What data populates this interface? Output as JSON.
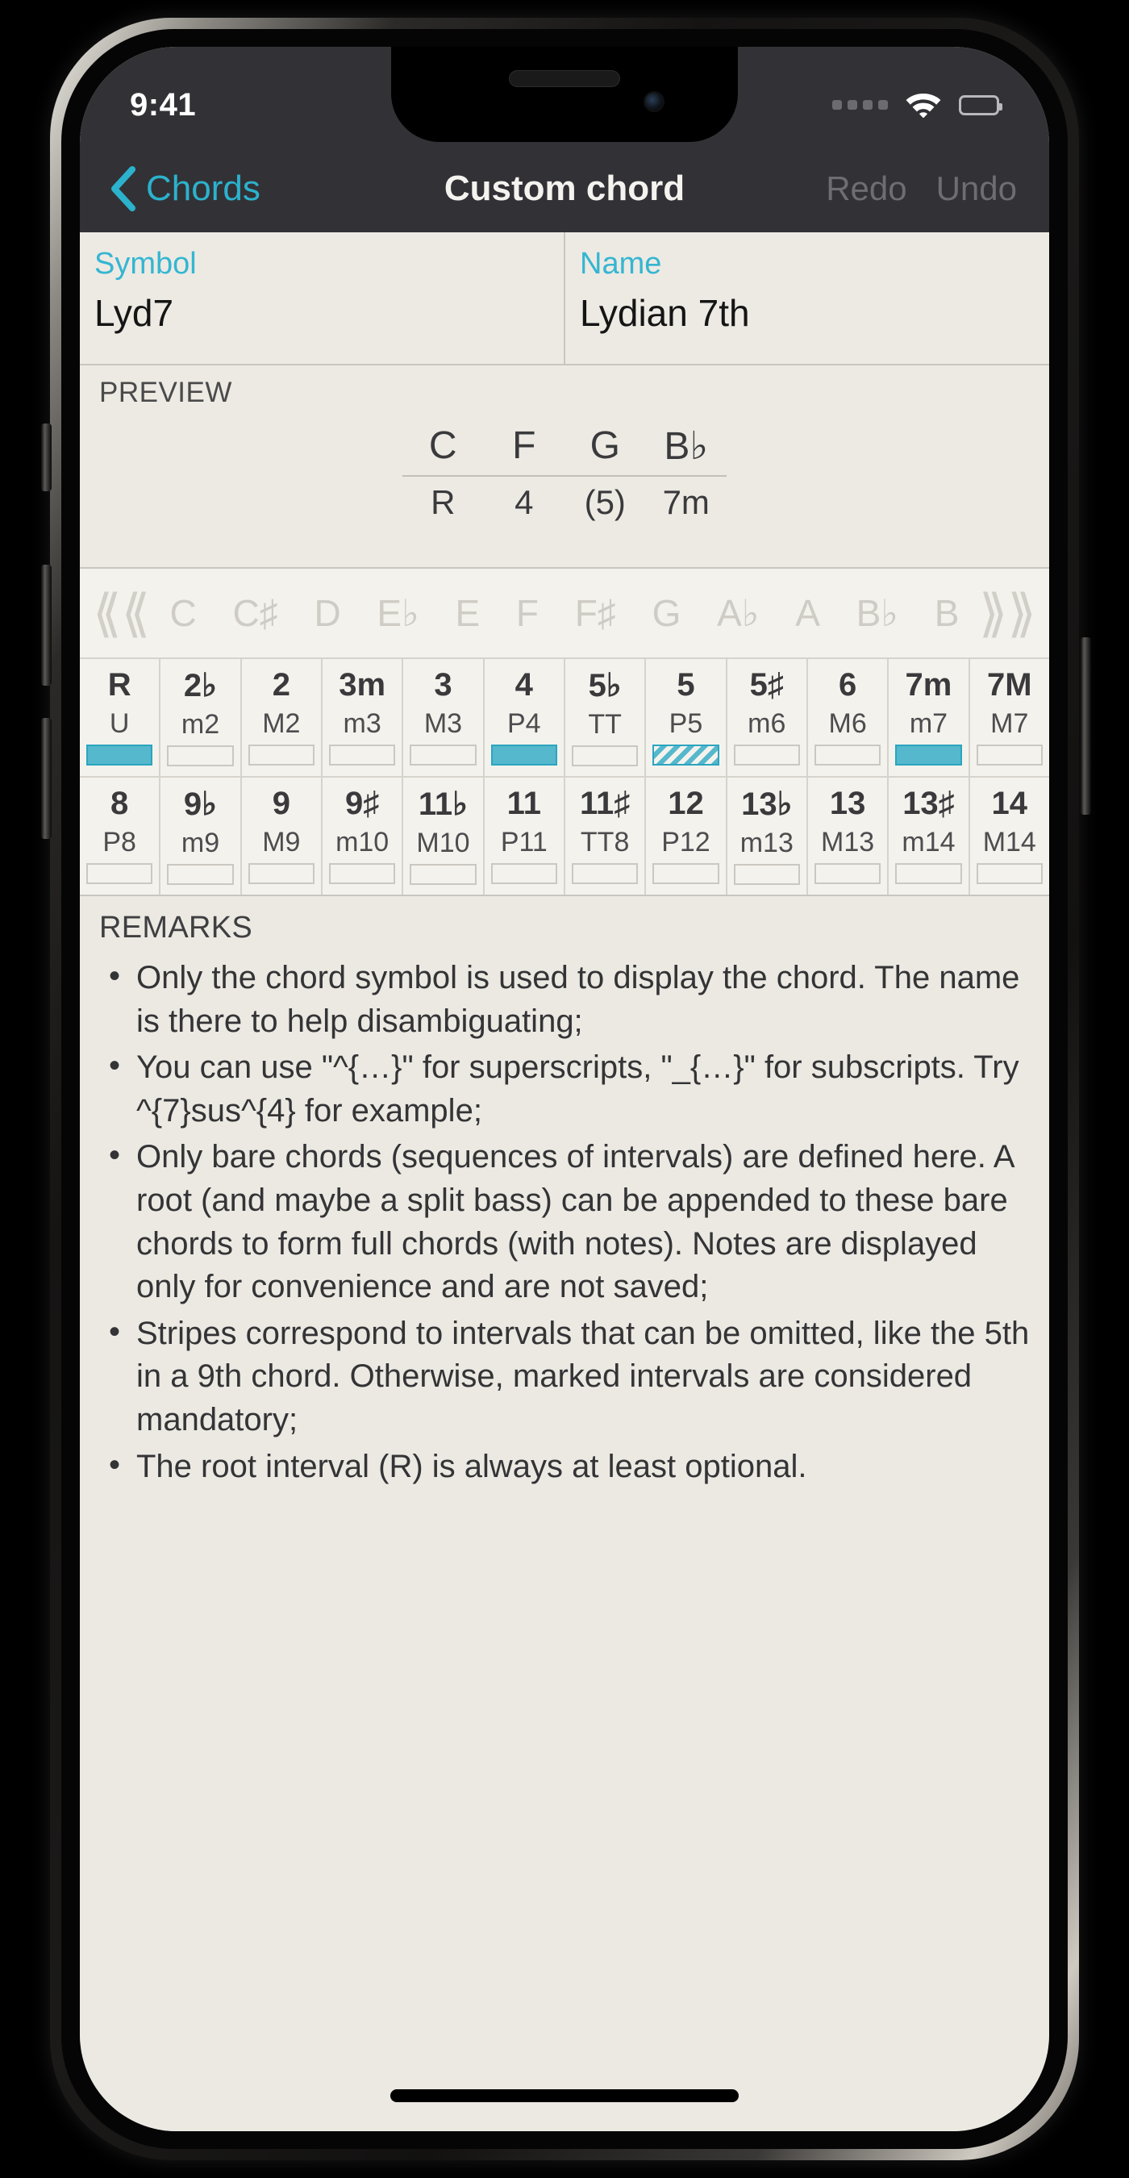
{
  "status_bar": {
    "time": "9:41",
    "cellular_icon": "cellular-dots-icon",
    "wifi_icon": "wifi-icon",
    "battery_icon": "battery-full-icon"
  },
  "nav_bar": {
    "back_icon": "chevron-left-icon",
    "back_label": "Chords",
    "title": "Custom chord",
    "redo_label": "Redo",
    "undo_label": "Undo"
  },
  "fields": {
    "symbol": {
      "label": "Symbol",
      "value": "Lyd7"
    },
    "name": {
      "label": "Name",
      "value": "Lydian 7th"
    }
  },
  "preview": {
    "label": "PREVIEW",
    "notes": [
      "C",
      "F",
      "G",
      "B♭"
    ],
    "intervals": [
      "R",
      "4",
      "(5)",
      "7m"
    ]
  },
  "note_picker": {
    "left_arrow_icon": "double-chevron-left-icon",
    "right_arrow_icon": "double-chevron-right-icon",
    "notes": [
      "C",
      "C♯",
      "D",
      "E♭",
      "E",
      "F",
      "F♯",
      "G",
      "A♭",
      "A",
      "B♭",
      "B"
    ]
  },
  "interval_grid": {
    "rows": [
      [
        {
          "main": "R",
          "sub": "U",
          "state": "on"
        },
        {
          "main": "2♭",
          "sub": "m2",
          "state": "off"
        },
        {
          "main": "2",
          "sub": "M2",
          "state": "off"
        },
        {
          "main": "3m",
          "sub": "m3",
          "state": "off"
        },
        {
          "main": "3",
          "sub": "M3",
          "state": "off"
        },
        {
          "main": "4",
          "sub": "P4",
          "state": "on"
        },
        {
          "main": "5♭",
          "sub": "TT",
          "state": "off"
        },
        {
          "main": "5",
          "sub": "P5",
          "state": "striped"
        },
        {
          "main": "5♯",
          "sub": "m6",
          "state": "off"
        },
        {
          "main": "6",
          "sub": "M6",
          "state": "off"
        },
        {
          "main": "7m",
          "sub": "m7",
          "state": "on"
        },
        {
          "main": "7M",
          "sub": "M7",
          "state": "off"
        }
      ],
      [
        {
          "main": "8",
          "sub": "P8",
          "state": "off"
        },
        {
          "main": "9♭",
          "sub": "m9",
          "state": "off"
        },
        {
          "main": "9",
          "sub": "M9",
          "state": "off"
        },
        {
          "main": "9♯",
          "sub": "m10",
          "state": "off"
        },
        {
          "main": "11♭",
          "sub": "M10",
          "state": "off"
        },
        {
          "main": "11",
          "sub": "P11",
          "state": "off"
        },
        {
          "main": "11♯",
          "sub": "TT8",
          "state": "off"
        },
        {
          "main": "12",
          "sub": "P12",
          "state": "off"
        },
        {
          "main": "13♭",
          "sub": "m13",
          "state": "off"
        },
        {
          "main": "13",
          "sub": "M13",
          "state": "off"
        },
        {
          "main": "13♯",
          "sub": "m14",
          "state": "off"
        },
        {
          "main": "14",
          "sub": "M14",
          "state": "off"
        }
      ]
    ]
  },
  "remarks": {
    "label": "REMARKS",
    "items": [
      "Only the chord symbol is used to display the chord. The name is there to help disambiguating;",
      "You can use \"^{…}\" for superscripts, \"_{…}\" for subscripts. Try ^{7}sus^{4} for example;",
      "Only bare chords (sequences of intervals) are defined here. A root (and maybe a split bass) can be appended to these bare chords to form full chords (with notes). Notes are displayed only for convenience and are not saved;",
      "Stripes correspond to intervals that can be omitted, like the 5th in a 9th chord. Otherwise, marked intervals are considered mandatory;",
      "The root interval (R) is always at least optional."
    ]
  },
  "colors": {
    "accent": "#2cb2cd",
    "marker_fill": "#55b8cc",
    "marker_border": "#2ba5c0",
    "nav_background": "#323236",
    "sheet_background": "#ece9e3"
  },
  "home_indicator": "home-indicator"
}
